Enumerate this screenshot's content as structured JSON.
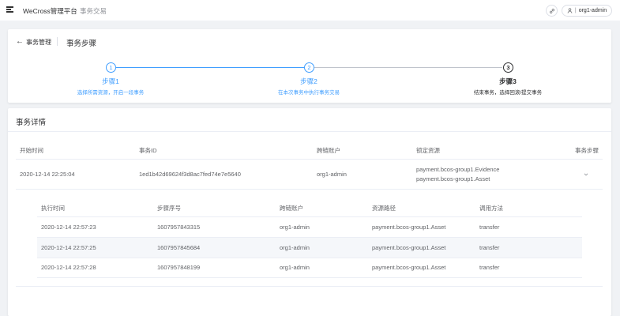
{
  "header": {
    "app_title": "WeCross管理平台",
    "separator": "/",
    "current_page": "事务交易",
    "user_label": "org1-admin",
    "icons": [
      "menu-icon",
      "link-icon",
      "user-icon"
    ]
  },
  "steps_card": {
    "back_label": "事务管理",
    "title": "事务步骤",
    "colors": {
      "done": "#409eff",
      "active": "#303133"
    },
    "steps": [
      {
        "number": "1",
        "title": "步骤1",
        "description": "选择所需资源，开启一段事务",
        "state": "done"
      },
      {
        "number": "2",
        "title": "步骤2",
        "description": "在本次事务中执行事务交易",
        "state": "done"
      },
      {
        "number": "3",
        "title": "步骤3",
        "description": "结束事务，选择回滚/提交事务",
        "state": "active"
      }
    ]
  },
  "details_card": {
    "title": "事务详情",
    "columns": [
      "开始时间",
      "事务ID",
      "跨链账户",
      "锁定资源",
      "事务步骤"
    ],
    "row": {
      "start_time": "2020-12-14 22:25:04",
      "tx_id": "1ed1b42d69624f3d8ac7fed74e7e5640",
      "account": "org1-admin",
      "resources": [
        "payment.bcos-group1.Evidence",
        "payment.bcos-group1.Asset"
      ]
    },
    "sub_columns": [
      "执行时间",
      "步骤序号",
      "跨链账户",
      "资源路径",
      "调用方法"
    ],
    "sub_rows": [
      {
        "time": "2020-12-14 22:57:23",
        "seq": "1607957843315",
        "account": "org1-admin",
        "path": "payment.bcos-group1.Asset",
        "method": "transfer"
      },
      {
        "time": "2020-12-14 22:57:25",
        "seq": "1607957845684",
        "account": "org1-admin",
        "path": "payment.bcos-group1.Asset",
        "method": "transfer"
      },
      {
        "time": "2020-12-14 22:57:28",
        "seq": "1607957848199",
        "account": "org1-admin",
        "path": "payment.bcos-group1.Asset",
        "method": "transfer"
      }
    ]
  }
}
